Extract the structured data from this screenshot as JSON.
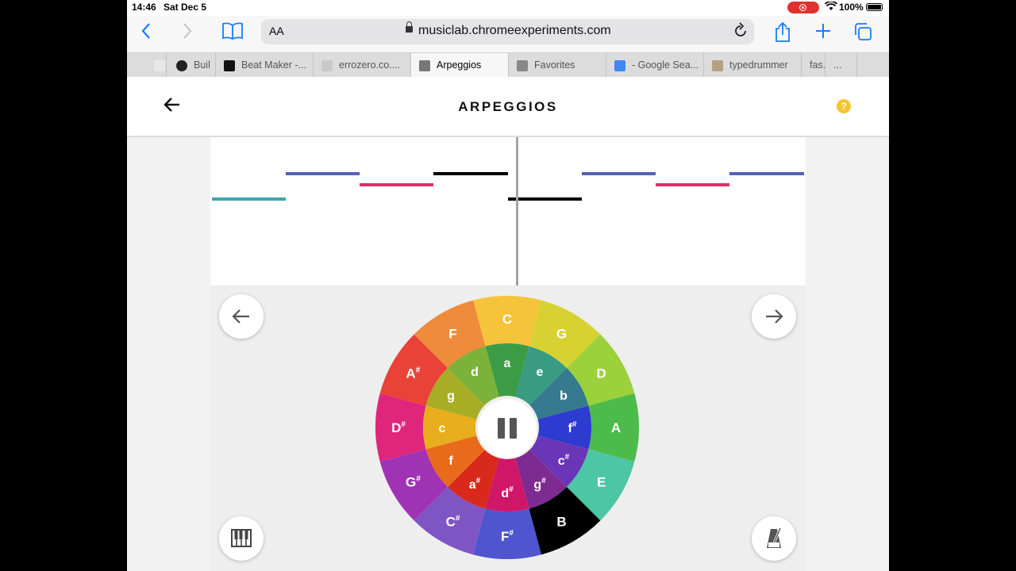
{
  "status": {
    "time": "14:46",
    "date": "Sat Dec 5",
    "battery": "100%"
  },
  "browser": {
    "aa_label": "AA",
    "url": "musiclab.chromeexperiments.com",
    "tabs": [
      {
        "label": "",
        "fav": "#e8e8e8"
      },
      {
        "label": "Buil",
        "fav": "#222"
      },
      {
        "label": "Beat Maker -...",
        "fav": "#111"
      },
      {
        "label": "errozero.co....",
        "fav": "#c9c9c9"
      },
      {
        "label": "Arpeggios",
        "fav": "#777",
        "active": true
      },
      {
        "label": "Favorites",
        "fav": "#888"
      },
      {
        "label": "- Google Sea...",
        "fav": "#4285f4"
      },
      {
        "label": "typedrummer",
        "fav": "#b5a080"
      },
      {
        "label": "fas.ha...",
        "fav": ""
      },
      {
        "label": "...",
        "fav": ""
      }
    ]
  },
  "app": {
    "title": "ARPEGGIOS",
    "help_label": "?"
  },
  "colors": {
    "black": "#000000",
    "teal": "#3aa7b0",
    "blue": "#5561b5",
    "pink": "#d6326e"
  },
  "wheel": {
    "outer": [
      {
        "label": "C",
        "sup": "",
        "color": "#f5c43a"
      },
      {
        "label": "G",
        "sup": "",
        "color": "#d7d232"
      },
      {
        "label": "D",
        "sup": "",
        "color": "#9bd13b"
      },
      {
        "label": "A",
        "sup": "",
        "color": "#4dbb4c"
      },
      {
        "label": "E",
        "sup": "",
        "color": "#4cc6a4"
      },
      {
        "label": "B",
        "sup": "",
        "color": "#000000"
      },
      {
        "label": "F",
        "sup": "#",
        "color": "#4e55cf"
      },
      {
        "label": "C",
        "sup": "#",
        "color": "#7f55c4"
      },
      {
        "label": "G",
        "sup": "#",
        "color": "#a033b3"
      },
      {
        "label": "D",
        "sup": "#",
        "color": "#e0257d"
      },
      {
        "label": "A",
        "sup": "#",
        "color": "#ea4238"
      },
      {
        "label": "F",
        "sup": "",
        "color": "#ee8c3b"
      }
    ],
    "inner": [
      {
        "label": "a",
        "sup": "",
        "color": "#3c9c45"
      },
      {
        "label": "e",
        "sup": "",
        "color": "#3a9b83"
      },
      {
        "label": "b",
        "sup": "",
        "color": "#357a8f"
      },
      {
        "label": "f",
        "sup": "#",
        "color": "#2e3bd0"
      },
      {
        "label": "c",
        "sup": "#",
        "color": "#6a35b6"
      },
      {
        "label": "g",
        "sup": "#",
        "color": "#7d2b91"
      },
      {
        "label": "d",
        "sup": "#",
        "color": "#cf1668"
      },
      {
        "label": "a",
        "sup": "#",
        "color": "#d8291c"
      },
      {
        "label": "f",
        "sup": "",
        "color": "#e96a1a"
      },
      {
        "label": "c",
        "sup": "",
        "color": "#e8ae1e"
      },
      {
        "label": "g",
        "sup": "",
        "color": "#a8ad26"
      },
      {
        "label": "d",
        "sup": "",
        "color": "#7bb23a"
      }
    ]
  }
}
